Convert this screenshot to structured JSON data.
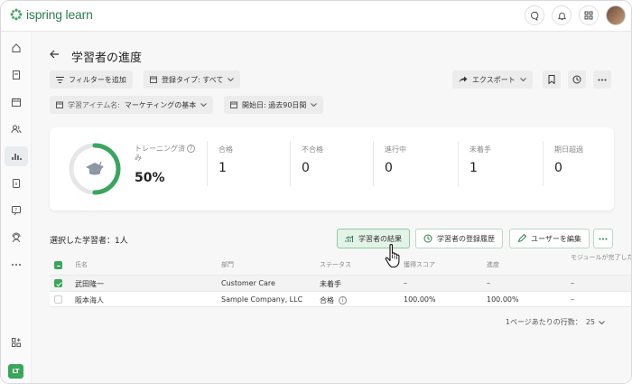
{
  "app": {
    "logo_text": "ispring learn"
  },
  "header": {
    "title": "学習者の進度",
    "filters": {
      "add_filter": "フィルターを追加",
      "registration_type": "登録タイプ: すべて",
      "item_name_label": "学習アイテム名:",
      "item_name_value": "マーケティングの基本",
      "start_date": "開始日: 過去90日間"
    },
    "export_label": "エクスポート"
  },
  "stats": {
    "progress_label": "トレーニング済み",
    "progress_value": "50%",
    "progress_fraction": 0.5,
    "items": [
      {
        "label": "合格",
        "value": "1"
      },
      {
        "label": "不合格",
        "value": "0"
      },
      {
        "label": "進行中",
        "value": "0"
      },
      {
        "label": "未着手",
        "value": "1"
      },
      {
        "label": "期日超過",
        "value": "0"
      }
    ]
  },
  "selection": {
    "text": "選択した学習者：1人"
  },
  "actions": {
    "results": "学習者の結果",
    "history": "学習者の登録履歴",
    "edit": "ユーザーを編集"
  },
  "table": {
    "columns": [
      "氏名",
      "部門",
      "ステータス",
      "獲得スコア",
      "進度",
      "モジュールが完了した"
    ],
    "rows": [
      {
        "name": "武田隆一",
        "department": "Customer Care",
        "status": "未着手",
        "score": "–",
        "progress": "–",
        "completed": "–",
        "selected": true
      },
      {
        "name": "阪本海人",
        "department": "Sample Company, LLC",
        "status": "合格",
        "score": "100.00%",
        "progress": "100.00%",
        "completed": "–",
        "selected": false
      }
    ]
  },
  "pager": {
    "label": "1ページあたりの行数：",
    "value": "25"
  },
  "sidebar": {
    "user_initials": "LT"
  },
  "colors": {
    "accent": "#3aa55d",
    "ring_bg": "#e6e6e6"
  }
}
